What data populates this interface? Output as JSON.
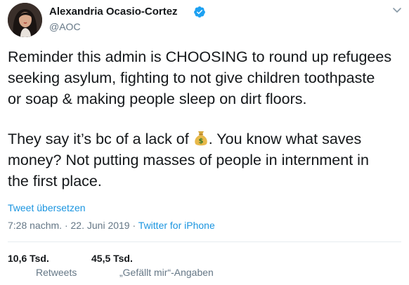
{
  "author": {
    "name": "Alexandria Ocasio-Cortez",
    "handle": "@AOC",
    "avatar_icon": "profile-photo",
    "verified_icon": "verified-badge-icon"
  },
  "menu_icon": "chevron-down-icon",
  "tweet": {
    "paragraph1": [
      "Reminder this admin is CHOOSING to round up refugees",
      "seeking asylum, fighting to not give children toothpaste",
      "or soap & making people sleep on dirt floors."
    ],
    "paragraph2": {
      "line1_before": "They say it’s bc of a lack of ",
      "line1_emoji": "money-bag-emoji",
      "line1_after": ". You know what saves",
      "line2": "money? Not putting masses of people in internment in",
      "line3": "the first place."
    }
  },
  "translate_label": "Tweet übersetzen",
  "meta": {
    "time": "7:28 nachm.",
    "separator": " · ",
    "date": "22. Juni 2019",
    "source": "Twitter for iPhone"
  },
  "stats": {
    "retweets": {
      "count": "10,6 Tsd.",
      "label": "Retweets"
    },
    "likes": {
      "count": "45,5 Tsd.",
      "label": "„Gefällt mir“-Angaben"
    }
  },
  "colors": {
    "link": "#1b95e0",
    "secondary_text": "#657786",
    "primary_text": "#14171a",
    "verified": "#1da1f2",
    "divider": "#e6ecf0"
  }
}
